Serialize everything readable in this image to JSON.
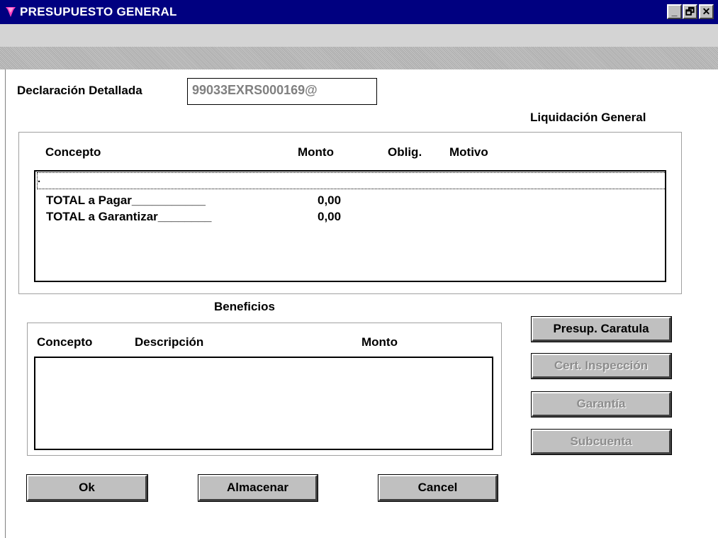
{
  "window": {
    "title": "PRESUPUESTO GENERAL",
    "controls": {
      "minimize": "_",
      "maximize": "🗗",
      "close": "✕"
    }
  },
  "form": {
    "declaracion_label": "Declaración Detallada",
    "declaracion_value": "99033EXRS000169@",
    "liquidacion_title": "Liquidación General"
  },
  "liquidacion": {
    "headers": {
      "concepto": "Concepto",
      "monto": "Monto",
      "oblig": "Oblig.",
      "motivo": "Motivo"
    },
    "dot": ".",
    "rows": [
      {
        "concepto": "TOTAL a Pagar___________",
        "monto": "0,00"
      },
      {
        "concepto": "TOTAL a Garantizar________",
        "monto": "0,00"
      }
    ]
  },
  "beneficios": {
    "title": "Beneficios",
    "headers": {
      "concepto": "Concepto",
      "descripcion": "Descripción",
      "monto": "Monto"
    }
  },
  "side_buttons": {
    "presup_caratula": "Presup. Caratula",
    "cert_inspeccion": "Cert. Inspección",
    "garantia": "Garantía",
    "subcuenta": "Subcuenta"
  },
  "bottom_buttons": {
    "ok": "Ok",
    "almacenar": "Almacenar",
    "cancel": "Cancel"
  },
  "colors": {
    "titlebar": "#000080",
    "button_face": "#c0c0c0",
    "disabled_text": "#8c8c8c"
  }
}
